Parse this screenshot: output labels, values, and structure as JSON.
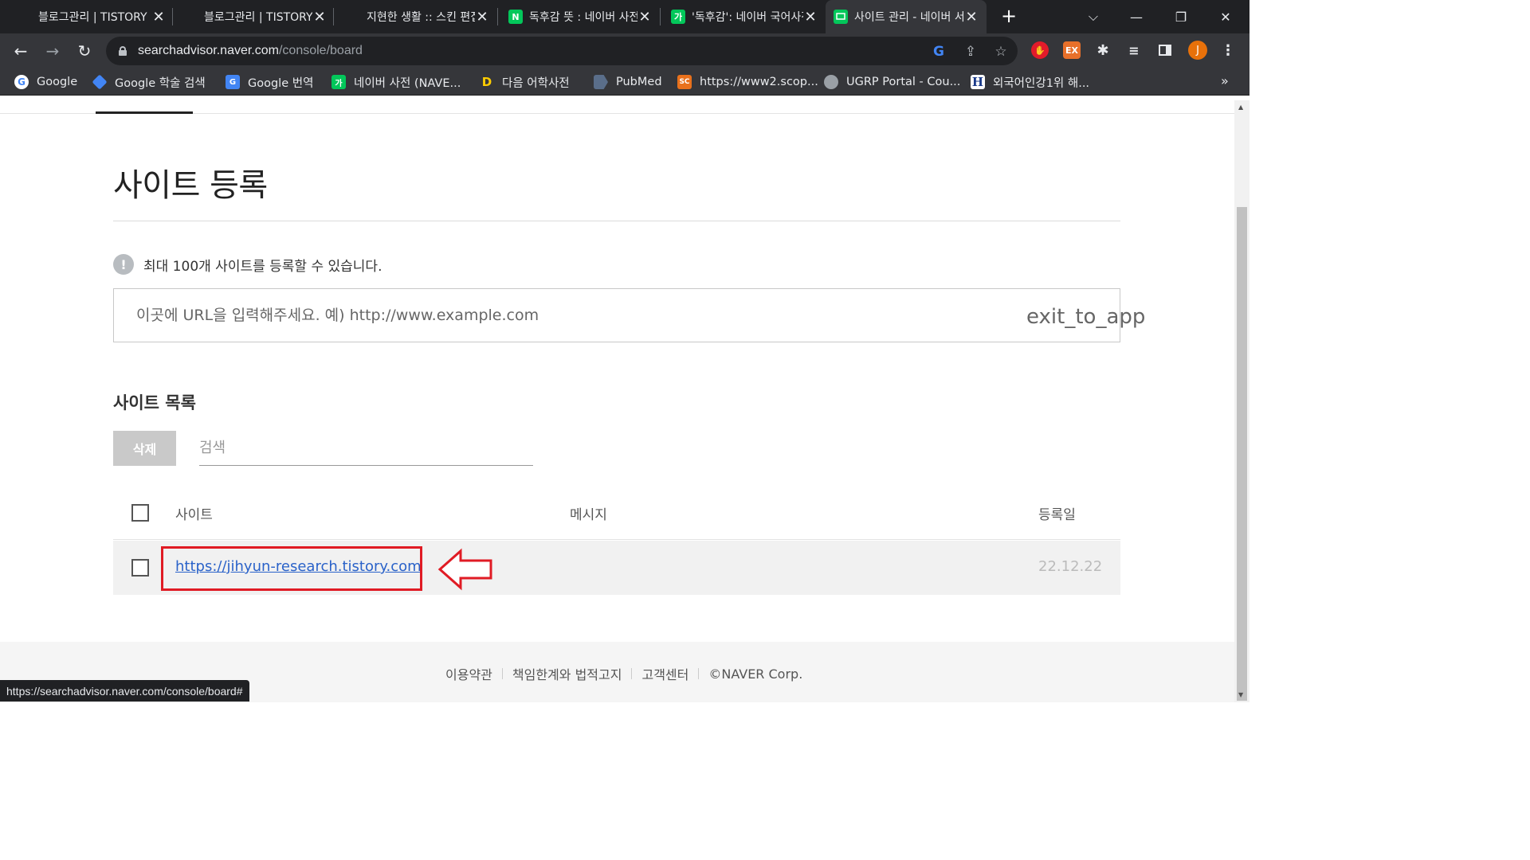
{
  "browser": {
    "tabs": [
      {
        "title": "블로그관리 | TISTORY",
        "favicon": "tistory-icon",
        "active": false
      },
      {
        "title": "블로그관리 | TISTORY",
        "favicon": "tistory-icon",
        "active": false
      },
      {
        "title": "지현한 생활 :: 스킨 편집",
        "favicon": "tistory-icon",
        "active": false
      },
      {
        "title": "독후감 뜻 : 네이버 사전",
        "favicon": "naver-n-icon",
        "favicon_text": "N",
        "active": false
      },
      {
        "title": "'독후감': 네이버 국어사전",
        "favicon": "naver-dict-icon",
        "favicon_text": "가",
        "active": false
      },
      {
        "title": "사이트 관리 - 네이버 서치어드바이저",
        "favicon": "search-advisor-icon",
        "active": true
      }
    ],
    "url_host": "searchadvisor.naver.com",
    "url_path": "/console/board",
    "bookmarks": [
      {
        "label": "Google",
        "icon": "google-icon"
      },
      {
        "label": "Google 학술 검색",
        "icon": "scholar-icon"
      },
      {
        "label": "Google 번역",
        "icon": "translate-icon"
      },
      {
        "label": "네이버 사전 (NAVE...",
        "icon": "naver-dict-icon",
        "icon_text": "가"
      },
      {
        "label": "다음 어학사전",
        "icon": "daum-icon",
        "icon_text": "D"
      },
      {
        "label": "PubMed",
        "icon": "pubmed-icon"
      },
      {
        "label": "https://www2.scop...",
        "icon": "scopus-icon",
        "icon_text": "SC"
      },
      {
        "label": "UGRP Portal - Cou...",
        "icon": "globe-icon"
      },
      {
        "label": "외국어인강1위 해...",
        "icon": "hackers-icon",
        "icon_text": "H"
      }
    ],
    "profile_initial": "J",
    "status_url": "https://searchadvisor.naver.com/console/board#"
  },
  "page": {
    "title": "사이트 등록",
    "notice": "최대 100개 사이트를 등록할 수 있습니다.",
    "url_placeholder": "이곳에 URL을 입력해주세요. 예) http://www.example.com",
    "submit_icon_text": "exit_to_app",
    "list_title": "사이트 목록",
    "delete_label": "삭제",
    "search_placeholder": "검색",
    "columns": {
      "site": "사이트",
      "message": "메시지",
      "date": "등록일"
    },
    "rows": [
      {
        "site": "https://jihyun-research.tistory.com",
        "message": "",
        "date": "22.12.22"
      }
    ],
    "footer": [
      "이용약관",
      "책임한계와 법적고지",
      "고객센터",
      "©NAVER Corp."
    ]
  },
  "colors": {
    "highlight": "#e01b24",
    "link": "#2a62c9",
    "naver_green": "#03c75a"
  }
}
